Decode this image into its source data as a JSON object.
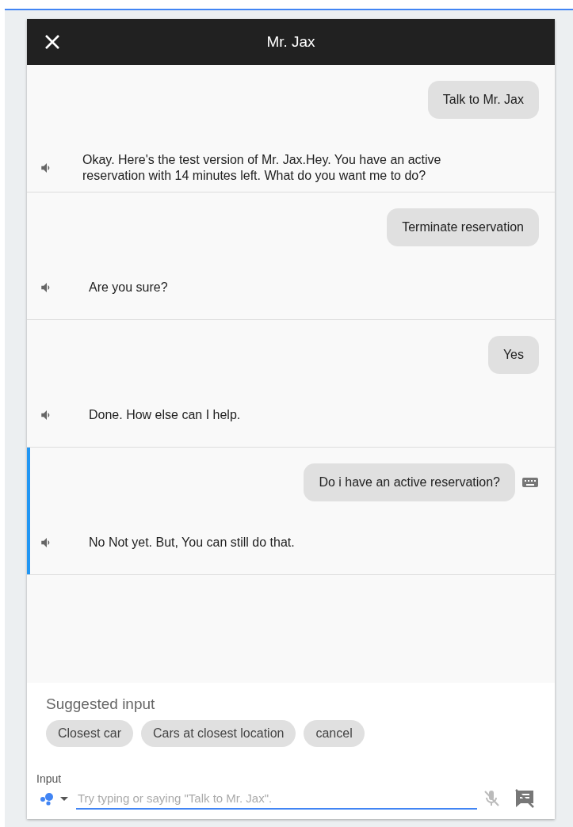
{
  "header": {
    "title": "Mr. Jax"
  },
  "turns": [
    {
      "user": "Talk to Mr. Jax",
      "typed": false,
      "reply": "Okay. Here's the test version of Mr. Jax.Hey. You have an active reservation with 14 minutes left. What do you want me to do?",
      "selected": false
    },
    {
      "user": "Terminate reservation",
      "typed": false,
      "reply": "Are you sure?",
      "selected": false
    },
    {
      "user": "Yes",
      "typed": false,
      "reply": "Done. How else can I help.",
      "selected": false
    },
    {
      "user": "Do i have an active reservation?",
      "typed": true,
      "reply": "No Not yet. But, You can still do that.",
      "selected": true
    }
  ],
  "suggestions": {
    "title": "Suggested input",
    "chips": [
      "Closest car",
      "Cars at closest location",
      "cancel"
    ]
  },
  "input": {
    "label": "Input",
    "placeholder": "Try typing or saying \"Talk to Mr. Jax\"."
  }
}
